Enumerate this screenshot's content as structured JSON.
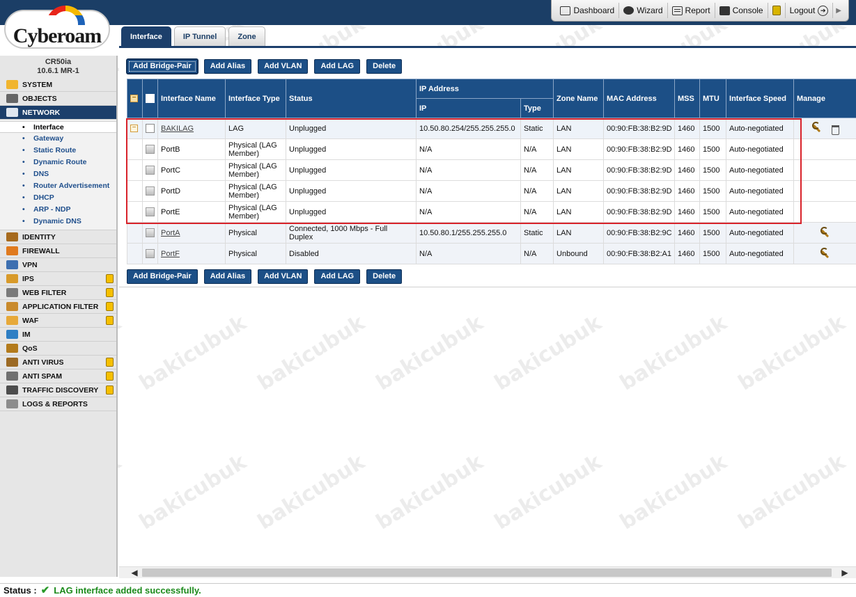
{
  "header": {
    "links": [
      {
        "label": "Dashboard",
        "icon": "dashboard-icon"
      },
      {
        "label": "Wizard",
        "icon": "wizard-icon"
      },
      {
        "label": "Report",
        "icon": "report-icon"
      },
      {
        "label": "Console",
        "icon": "console-icon"
      },
      {
        "label": "Logout",
        "icon": "logout-icon"
      }
    ]
  },
  "logo": {
    "text": "Cyberoam"
  },
  "device": {
    "model": "CR50ia",
    "version": "10.6.1 MR-1"
  },
  "sidebar": {
    "items": [
      {
        "label": "SYSTEM",
        "icon": "system-icon",
        "locked": false
      },
      {
        "label": "OBJECTS",
        "icon": "objects-icon",
        "locked": false
      },
      {
        "label": "NETWORK",
        "icon": "network-icon",
        "locked": false,
        "active": true
      },
      {
        "label": "IDENTITY",
        "icon": "identity-icon",
        "locked": false
      },
      {
        "label": "FIREWALL",
        "icon": "firewall-icon",
        "locked": false
      },
      {
        "label": "VPN",
        "icon": "vpn-icon",
        "locked": false
      },
      {
        "label": "IPS",
        "icon": "ips-icon",
        "locked": true
      },
      {
        "label": "WEB FILTER",
        "icon": "web-filter-icon",
        "locked": true
      },
      {
        "label": "APPLICATION FILTER",
        "icon": "application-filter-icon",
        "locked": true
      },
      {
        "label": "WAF",
        "icon": "waf-icon",
        "locked": true
      },
      {
        "label": "IM",
        "icon": "im-icon",
        "locked": false
      },
      {
        "label": "QoS",
        "icon": "qos-icon",
        "locked": false
      },
      {
        "label": "ANTI VIRUS",
        "icon": "anti-virus-icon",
        "locked": true
      },
      {
        "label": "ANTI SPAM",
        "icon": "anti-spam-icon",
        "locked": true
      },
      {
        "label": "TRAFFIC DISCOVERY",
        "icon": "traffic-discovery-icon",
        "locked": true
      },
      {
        "label": "LOGS & REPORTS",
        "icon": "logs-reports-icon",
        "locked": false
      }
    ],
    "network_sub": [
      "Interface",
      "Gateway",
      "Static Route",
      "Dynamic Route",
      "DNS",
      "Router Advertisement",
      "DHCP",
      "ARP - NDP",
      "Dynamic DNS"
    ]
  },
  "tabs": [
    "Interface",
    "IP Tunnel",
    "Zone"
  ],
  "buttons": {
    "bridge": "Add Bridge-Pair",
    "alias": "Add Alias",
    "vlan": "Add VLAN",
    "lag": "Add LAG",
    "delete": "Delete"
  },
  "table": {
    "headers": {
      "name": "Interface Name",
      "type": "Interface Type",
      "status": "Status",
      "ip_address": "IP Address",
      "ip": "IP",
      "ip_type": "Type",
      "zone": "Zone Name",
      "mac": "MAC Address",
      "mss": "MSS",
      "mtu": "MTU",
      "speed": "Interface Speed",
      "manage": "Manage"
    },
    "rows": [
      {
        "name": "BAKILAG",
        "type": "LAG",
        "status": "Unplugged",
        "ip": "10.50.80.254/255.255.255.0",
        "ip_type": "Static",
        "zone": "LAN",
        "mac": "00:90:FB:38:B2:9D",
        "mss": "1460",
        "mtu": "1500",
        "speed": "Auto-negotiated"
      },
      {
        "name": "PortB",
        "type": "Physical (LAG Member)",
        "status": "Unplugged",
        "ip": "N/A",
        "ip_type": "N/A",
        "zone": "LAN",
        "mac": "00:90:FB:38:B2:9D",
        "mss": "1460",
        "mtu": "1500",
        "speed": "Auto-negotiated"
      },
      {
        "name": "PortC",
        "type": "Physical (LAG Member)",
        "status": "Unplugged",
        "ip": "N/A",
        "ip_type": "N/A",
        "zone": "LAN",
        "mac": "00:90:FB:38:B2:9D",
        "mss": "1460",
        "mtu": "1500",
        "speed": "Auto-negotiated"
      },
      {
        "name": "PortD",
        "type": "Physical (LAG Member)",
        "status": "Unplugged",
        "ip": "N/A",
        "ip_type": "N/A",
        "zone": "LAN",
        "mac": "00:90:FB:38:B2:9D",
        "mss": "1460",
        "mtu": "1500",
        "speed": "Auto-negotiated"
      },
      {
        "name": "PortE",
        "type": "Physical (LAG Member)",
        "status": "Unplugged",
        "ip": "N/A",
        "ip_type": "N/A",
        "zone": "LAN",
        "mac": "00:90:FB:38:B2:9D",
        "mss": "1460",
        "mtu": "1500",
        "speed": "Auto-negotiated"
      },
      {
        "name": "PortA",
        "type": "Physical",
        "status": "Connected, 1000 Mbps - Full Duplex",
        "ip": "10.50.80.1/255.255.255.0",
        "ip_type": "Static",
        "zone": "LAN",
        "mac": "00:90:FB:38:B2:9C",
        "mss": "1460",
        "mtu": "1500",
        "speed": "Auto-negotiated"
      },
      {
        "name": "PortF",
        "type": "Physical",
        "status": "Disabled",
        "ip": "N/A",
        "ip_type": "N/A",
        "zone": "Unbound",
        "mac": "00:90:FB:38:B2:A1",
        "mss": "1460",
        "mtu": "1500",
        "speed": "Auto-negotiated"
      }
    ]
  },
  "status": {
    "label": "Status :",
    "message": "LAG interface added successfully."
  },
  "watermark": "bakicubuk",
  "colors": {
    "navy": "#1c3f6b",
    "button": "#1c4f86",
    "highlight_box": "#d8222a",
    "success": "#1b8a1b",
    "lock": "#f6c000"
  }
}
